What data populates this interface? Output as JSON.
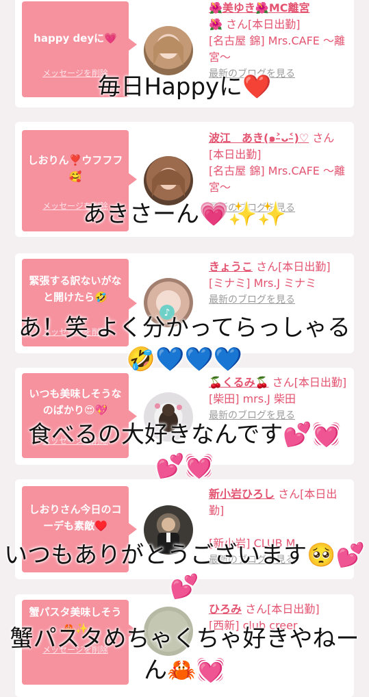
{
  "cards": [
    {
      "message": "happy deyに💗",
      "delete_label": "メッセージを削除",
      "name": "🌺美ゆき🌺MC離宮",
      "name_suffix": "🌺 さん[本日出勤]",
      "shop": "[名古屋 錦] Mrs.CAFE 〜離宮〜",
      "blog_label": "最新のブログを見る"
    },
    {
      "message": "しおりん❣️ウフフフ🥰",
      "delete_label": "メッセージを削除",
      "name": "波江　あき(๑˃̵ᴗ˂̵)♡",
      "name_suffix": "さん[本日出勤]",
      "shop": "[名古屋 錦] Mrs.CAFE 〜離宮〜",
      "blog_label": "最新のブログを見る"
    },
    {
      "message": "緊張する訳ないがなと開けたら🤣",
      "delete_label": "メッセージを削除",
      "name": "きょうこ",
      "name_suffix": "さん[本日出勤]",
      "shop": "[ミナミ] Mrs.J ミナミ",
      "blog_label": "最新のブログを見る"
    },
    {
      "message": "いつも美味しそうなのばかり😍💖",
      "delete_label": "メッセージを削除",
      "name": "🍒くるみ🍒",
      "name_suffix": "さん[本日出勤]",
      "shop": "[柴田] mrs.J 柴田",
      "blog_label": "最新のブログを見る"
    },
    {
      "message": "しおりさん今日のコーデも素敵♥️",
      "delete_label": "メッセージを削除",
      "name": "新小岩ひろし",
      "name_suffix": "さん[本日出勤]",
      "shop": "[新小岩] CLUB M.",
      "blog_label": "最新のブログを見る"
    },
    {
      "message": "蟹パスタ美味しそう🦀✨",
      "delete_label": "メッセージを削除",
      "name": "ひろみ",
      "name_suffix": "さん[本日出勤]",
      "shop": "[西新] club creer",
      "blog_label": "最新のブログを見る"
    }
  ],
  "overlays": [
    "毎日Happyに❤️",
    "あきさーん💗✨✨",
    "あ！笑 よく分かってらっしゃる🤣💙💙💙",
    "食べるの大好きなんです💕💓💕💓",
    "いつもありがとうございます🥺💕💕",
    "蟹パスタめちゃくちゃ好きやねーん🦀💓"
  ],
  "colors": {
    "bubble": "#f6919e",
    "name_text": "#e3526f",
    "blog_text": "#9b9b9b",
    "background": "#f4f0f1"
  }
}
